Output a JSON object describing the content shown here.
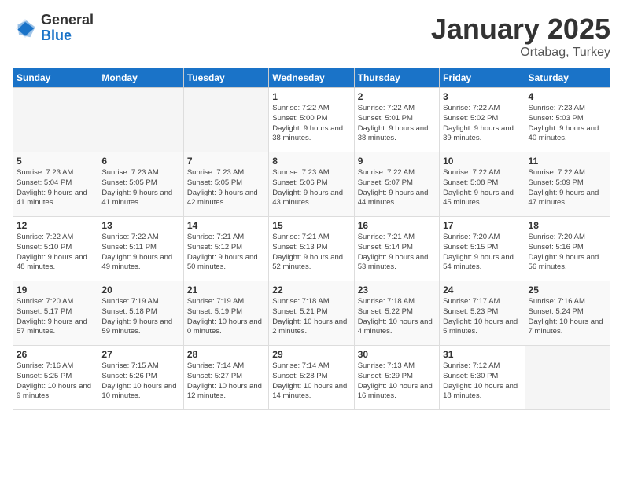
{
  "logo": {
    "general": "General",
    "blue": "Blue"
  },
  "header": {
    "month": "January 2025",
    "location": "Ortabag, Turkey"
  },
  "weekdays": [
    "Sunday",
    "Monday",
    "Tuesday",
    "Wednesday",
    "Thursday",
    "Friday",
    "Saturday"
  ],
  "weeks": [
    [
      {
        "day": "",
        "sunrise": "",
        "sunset": "",
        "daylight": ""
      },
      {
        "day": "",
        "sunrise": "",
        "sunset": "",
        "daylight": ""
      },
      {
        "day": "",
        "sunrise": "",
        "sunset": "",
        "daylight": ""
      },
      {
        "day": "1",
        "sunrise": "Sunrise: 7:22 AM",
        "sunset": "Sunset: 5:00 PM",
        "daylight": "Daylight: 9 hours and 38 minutes."
      },
      {
        "day": "2",
        "sunrise": "Sunrise: 7:22 AM",
        "sunset": "Sunset: 5:01 PM",
        "daylight": "Daylight: 9 hours and 38 minutes."
      },
      {
        "day": "3",
        "sunrise": "Sunrise: 7:22 AM",
        "sunset": "Sunset: 5:02 PM",
        "daylight": "Daylight: 9 hours and 39 minutes."
      },
      {
        "day": "4",
        "sunrise": "Sunrise: 7:23 AM",
        "sunset": "Sunset: 5:03 PM",
        "daylight": "Daylight: 9 hours and 40 minutes."
      }
    ],
    [
      {
        "day": "5",
        "sunrise": "Sunrise: 7:23 AM",
        "sunset": "Sunset: 5:04 PM",
        "daylight": "Daylight: 9 hours and 41 minutes."
      },
      {
        "day": "6",
        "sunrise": "Sunrise: 7:23 AM",
        "sunset": "Sunset: 5:05 PM",
        "daylight": "Daylight: 9 hours and 41 minutes."
      },
      {
        "day": "7",
        "sunrise": "Sunrise: 7:23 AM",
        "sunset": "Sunset: 5:05 PM",
        "daylight": "Daylight: 9 hours and 42 minutes."
      },
      {
        "day": "8",
        "sunrise": "Sunrise: 7:23 AM",
        "sunset": "Sunset: 5:06 PM",
        "daylight": "Daylight: 9 hours and 43 minutes."
      },
      {
        "day": "9",
        "sunrise": "Sunrise: 7:22 AM",
        "sunset": "Sunset: 5:07 PM",
        "daylight": "Daylight: 9 hours and 44 minutes."
      },
      {
        "day": "10",
        "sunrise": "Sunrise: 7:22 AM",
        "sunset": "Sunset: 5:08 PM",
        "daylight": "Daylight: 9 hours and 45 minutes."
      },
      {
        "day": "11",
        "sunrise": "Sunrise: 7:22 AM",
        "sunset": "Sunset: 5:09 PM",
        "daylight": "Daylight: 9 hours and 47 minutes."
      }
    ],
    [
      {
        "day": "12",
        "sunrise": "Sunrise: 7:22 AM",
        "sunset": "Sunset: 5:10 PM",
        "daylight": "Daylight: 9 hours and 48 minutes."
      },
      {
        "day": "13",
        "sunrise": "Sunrise: 7:22 AM",
        "sunset": "Sunset: 5:11 PM",
        "daylight": "Daylight: 9 hours and 49 minutes."
      },
      {
        "day": "14",
        "sunrise": "Sunrise: 7:21 AM",
        "sunset": "Sunset: 5:12 PM",
        "daylight": "Daylight: 9 hours and 50 minutes."
      },
      {
        "day": "15",
        "sunrise": "Sunrise: 7:21 AM",
        "sunset": "Sunset: 5:13 PM",
        "daylight": "Daylight: 9 hours and 52 minutes."
      },
      {
        "day": "16",
        "sunrise": "Sunrise: 7:21 AM",
        "sunset": "Sunset: 5:14 PM",
        "daylight": "Daylight: 9 hours and 53 minutes."
      },
      {
        "day": "17",
        "sunrise": "Sunrise: 7:20 AM",
        "sunset": "Sunset: 5:15 PM",
        "daylight": "Daylight: 9 hours and 54 minutes."
      },
      {
        "day": "18",
        "sunrise": "Sunrise: 7:20 AM",
        "sunset": "Sunset: 5:16 PM",
        "daylight": "Daylight: 9 hours and 56 minutes."
      }
    ],
    [
      {
        "day": "19",
        "sunrise": "Sunrise: 7:20 AM",
        "sunset": "Sunset: 5:17 PM",
        "daylight": "Daylight: 9 hours and 57 minutes."
      },
      {
        "day": "20",
        "sunrise": "Sunrise: 7:19 AM",
        "sunset": "Sunset: 5:18 PM",
        "daylight": "Daylight: 9 hours and 59 minutes."
      },
      {
        "day": "21",
        "sunrise": "Sunrise: 7:19 AM",
        "sunset": "Sunset: 5:19 PM",
        "daylight": "Daylight: 10 hours and 0 minutes."
      },
      {
        "day": "22",
        "sunrise": "Sunrise: 7:18 AM",
        "sunset": "Sunset: 5:21 PM",
        "daylight": "Daylight: 10 hours and 2 minutes."
      },
      {
        "day": "23",
        "sunrise": "Sunrise: 7:18 AM",
        "sunset": "Sunset: 5:22 PM",
        "daylight": "Daylight: 10 hours and 4 minutes."
      },
      {
        "day": "24",
        "sunrise": "Sunrise: 7:17 AM",
        "sunset": "Sunset: 5:23 PM",
        "daylight": "Daylight: 10 hours and 5 minutes."
      },
      {
        "day": "25",
        "sunrise": "Sunrise: 7:16 AM",
        "sunset": "Sunset: 5:24 PM",
        "daylight": "Daylight: 10 hours and 7 minutes."
      }
    ],
    [
      {
        "day": "26",
        "sunrise": "Sunrise: 7:16 AM",
        "sunset": "Sunset: 5:25 PM",
        "daylight": "Daylight: 10 hours and 9 minutes."
      },
      {
        "day": "27",
        "sunrise": "Sunrise: 7:15 AM",
        "sunset": "Sunset: 5:26 PM",
        "daylight": "Daylight: 10 hours and 10 minutes."
      },
      {
        "day": "28",
        "sunrise": "Sunrise: 7:14 AM",
        "sunset": "Sunset: 5:27 PM",
        "daylight": "Daylight: 10 hours and 12 minutes."
      },
      {
        "day": "29",
        "sunrise": "Sunrise: 7:14 AM",
        "sunset": "Sunset: 5:28 PM",
        "daylight": "Daylight: 10 hours and 14 minutes."
      },
      {
        "day": "30",
        "sunrise": "Sunrise: 7:13 AM",
        "sunset": "Sunset: 5:29 PM",
        "daylight": "Daylight: 10 hours and 16 minutes."
      },
      {
        "day": "31",
        "sunrise": "Sunrise: 7:12 AM",
        "sunset": "Sunset: 5:30 PM",
        "daylight": "Daylight: 10 hours and 18 minutes."
      },
      {
        "day": "",
        "sunrise": "",
        "sunset": "",
        "daylight": ""
      }
    ]
  ]
}
